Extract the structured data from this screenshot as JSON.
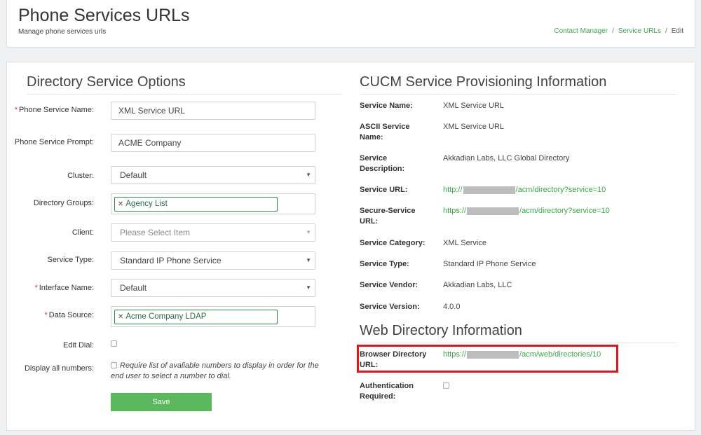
{
  "header": {
    "title": "Phone Services URLs",
    "subtitle": "Manage phone services urls",
    "breadcrumb": [
      "Contact Manager",
      "Service URLs",
      "Edit"
    ]
  },
  "left": {
    "section_title": "Directory Service Options",
    "fields": {
      "phone_service_name": {
        "label": "Phone Service Name:",
        "value": "XML Service URL"
      },
      "phone_service_prompt": {
        "label": "Phone Service Prompt:",
        "value": "ACME Company"
      },
      "cluster": {
        "label": "Cluster:",
        "value": "Default"
      },
      "directory_groups": {
        "label": "Directory Groups:",
        "tag": "Agency List"
      },
      "client": {
        "label": "Client:",
        "placeholder": "Please Select Item"
      },
      "service_type": {
        "label": "Service Type:",
        "value": "Standard IP Phone Service"
      },
      "interface_name": {
        "label": "Interface Name:",
        "value": "Default"
      },
      "data_source": {
        "label": "Data Source:",
        "tag": "Acme Company LDAP"
      },
      "edit_dial": {
        "label": "Edit Dial:"
      },
      "display_all_numbers": {
        "label": "Display all numbers:",
        "hint": "Require list of avaliable numbers to display in order for the end user to select a number to dial."
      }
    },
    "required_mark": "*",
    "save_label": "Save"
  },
  "right": {
    "section_title": "CUCM Service Provisioning Information",
    "rows": {
      "service_name": {
        "label": "Service Name:",
        "value": "XML Service URL"
      },
      "ascii_service_name": {
        "label": "ASCII Service Name:",
        "value": "XML Service URL"
      },
      "service_description": {
        "label": "Service Description:",
        "value": "Akkadian Labs, LLC Global Directory"
      },
      "service_url": {
        "label": "Service URL:",
        "prefix": "http://",
        "suffix": "/acm/directory?service=10"
      },
      "secure_service_url": {
        "label": "Secure-Service URL:",
        "prefix": "https://",
        "suffix": "/acm/directory?service=10"
      },
      "service_category": {
        "label": "Service Category:",
        "value": "XML Service"
      },
      "service_type": {
        "label": "Service Type:",
        "value": "Standard IP Phone Service"
      },
      "service_vendor": {
        "label": "Service Vendor:",
        "value": "Akkadian Labs, LLC"
      },
      "service_version": {
        "label": "Service Version:",
        "value": "4.0.0"
      }
    },
    "web_title": "Web Directory Information",
    "web_rows": {
      "browser_directory_url": {
        "label": "Browser Directory URL:",
        "prefix": "https://",
        "suffix": "/acm/web/directories/10"
      },
      "authentication_required": {
        "label": "Authentication Required:"
      }
    }
  },
  "colors": {
    "accent": "#3ea849",
    "button": "#5cb85c",
    "highlight": "#e0141e",
    "required": "#d9312f"
  },
  "icons": [
    "remove-tag-icon",
    "dropdown-caret-icon",
    "checkbox-icon"
  ]
}
